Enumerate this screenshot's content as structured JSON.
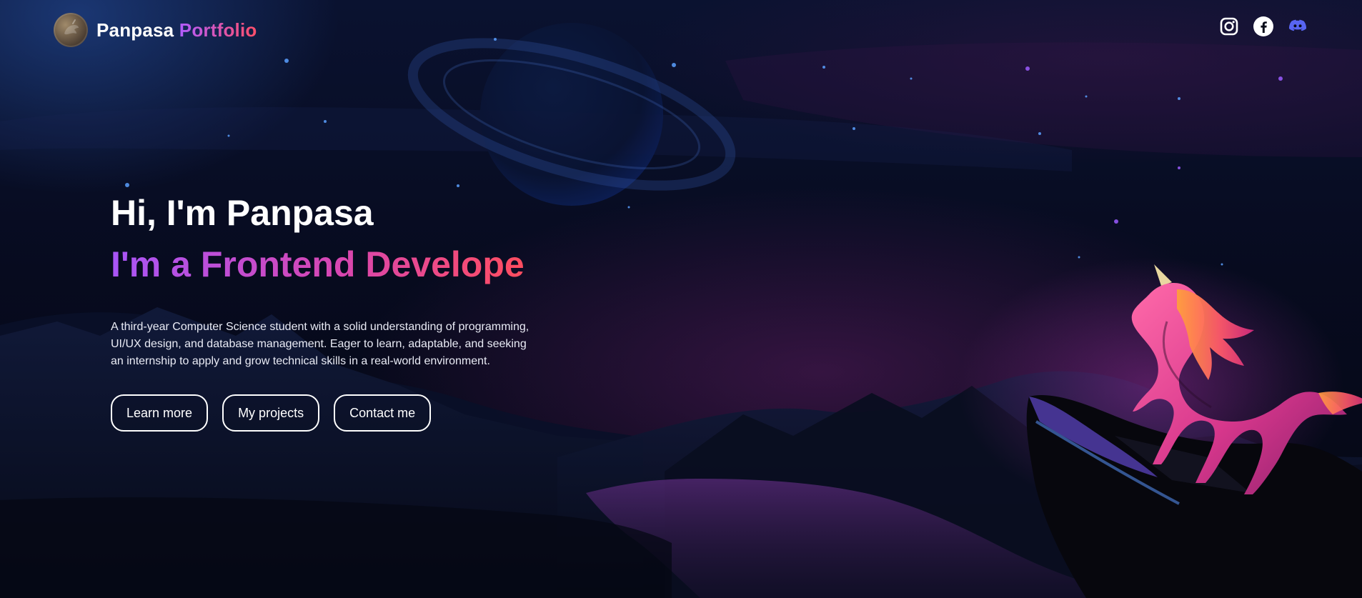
{
  "header": {
    "brand_first": "Panpasa",
    "brand_second": "Portfolio",
    "logo_icon": "unicorn-avatar-icon"
  },
  "social": [
    {
      "name": "instagram-icon",
      "color": "#ffffff"
    },
    {
      "name": "facebook-icon",
      "color": "#ffffff"
    },
    {
      "name": "discord-icon",
      "color": "#5865F2"
    }
  ],
  "hero": {
    "greeting": "Hi, I'm Panpasa",
    "role": "I'm a Frontend Develope",
    "description": "A third-year Computer Science student with a solid understanding of programming, UI/UX design, and database management. Eager to learn, adaptable, and seeking an internship to apply and grow technical skills in a real-world environment.",
    "buttons": {
      "learn_more": "Learn more",
      "my_projects": "My projects",
      "contact_me": "Contact me"
    }
  },
  "colors": {
    "accent_purple": "#a855f7",
    "accent_pink": "#ff4d5f",
    "background": "#070a18"
  },
  "illustration": {
    "subject": "unicorn-on-cliff",
    "background": "starry-night-with-planet-and-mountains"
  }
}
